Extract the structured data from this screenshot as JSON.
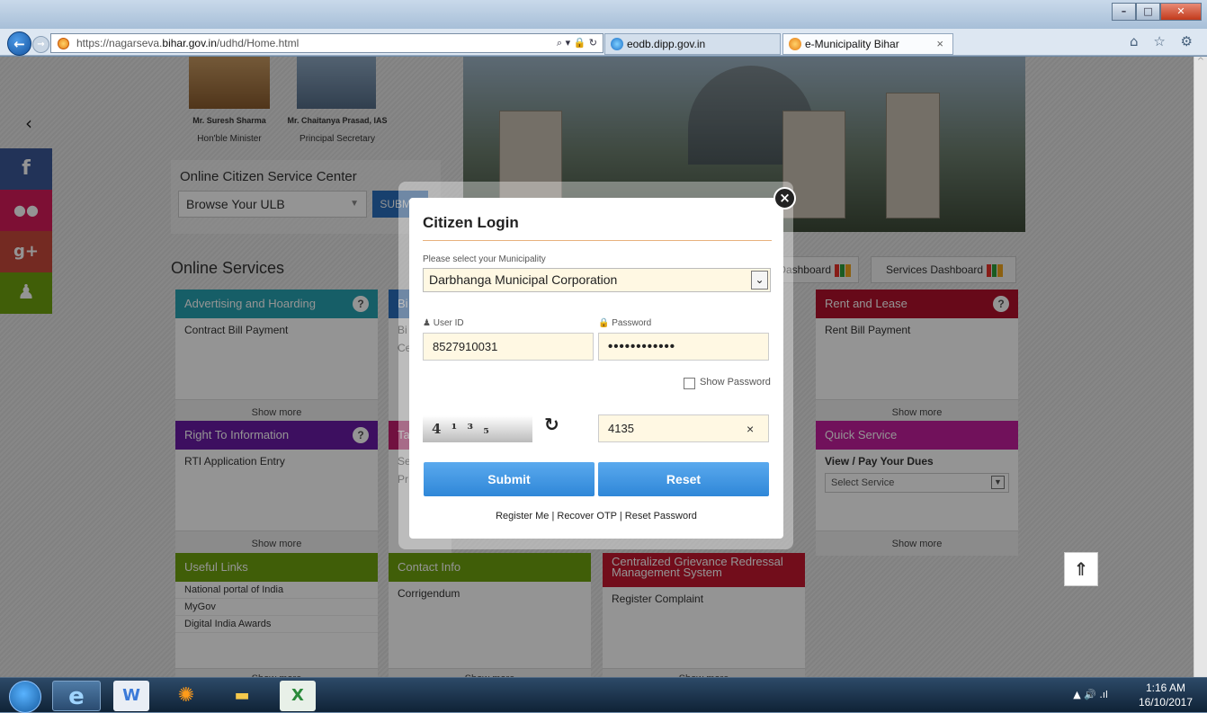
{
  "browser": {
    "url_prefix": "https://nagarseva.",
    "url_domain": "bihar.gov.in",
    "url_path": "/udhd/Home.html",
    "search_glyphs": "⌕ ▾ 🔒 ↻",
    "tabs": [
      {
        "label": "eodb.dipp.gov.in"
      },
      {
        "label": "e-Municipality Bihar",
        "close": "×"
      }
    ],
    "icons": "⌂ ☆ ⚙"
  },
  "page": {
    "officials": [
      {
        "name": "Mr. Suresh Sharma",
        "role": "Hon'ble Minister"
      },
      {
        "name": "Mr. Chaitanya Prasad, IAS",
        "role": "Principal Secretary"
      }
    ],
    "occ": {
      "title": "Online Citizen Service Center",
      "select": "Browse Your ULB",
      "submit": "SUBMIT"
    },
    "online_services": "Online Services",
    "dashboards": [
      {
        "label": "Dashboard"
      },
      {
        "label": "Services Dashboard"
      }
    ],
    "cards": [
      {
        "title": "Advertising and Hoarding",
        "items": [
          "Contract Bill Payment"
        ],
        "more": "Show more",
        "color": "#27a3b1"
      },
      {
        "title": "Rent and Lease",
        "items": [
          "Rent Bill Payment"
        ],
        "more": "Show more",
        "color": "#b2102b"
      },
      {
        "title": "Right To Information",
        "items": [
          "RTI Application Entry"
        ],
        "more": "Show more",
        "color": "#6a1aa5"
      },
      {
        "title": "Quick Service",
        "sub": "View / Pay Your Dues",
        "select": "Select Service",
        "more": "Show more",
        "color": "#c31e9e"
      },
      {
        "title": "Useful Links",
        "items": [
          "National portal of India",
          "MyGov",
          "Digital India Awards"
        ],
        "more": "Show more",
        "color": "#6fa30f"
      },
      {
        "title": "Contact Info",
        "items": [
          "Corrigendum"
        ],
        "more": "Show more",
        "color": "#6fa30f"
      },
      {
        "title": "Centralized Grievance Redressal Management System",
        "items": [
          "Register Complaint"
        ],
        "more": "Show more",
        "color": "#c4172f"
      }
    ],
    "partial": {
      "a": "Bi",
      "b": "Bi",
      "c": "Ce",
      "d": "Ta",
      "e": "Se",
      "f": "Pr"
    }
  },
  "modal": {
    "title": "Citizen Login",
    "municipality_label": "Please select your Municipality",
    "municipality": "Darbhanga Municipal Corporation",
    "userid_label": "User ID",
    "userid": "8527910031",
    "password_label": "Password",
    "password": "••••••••••••",
    "show_password": "Show Password",
    "captcha": "4 ¹ ³ ₅",
    "captcha_input": "4135",
    "submit": "Submit",
    "reset": "Reset",
    "links": [
      "Register Me",
      "Recover OTP",
      "Reset Password"
    ]
  },
  "taskbar": {
    "time": "1:16 AM",
    "date": "16/10/2017"
  },
  "colors": {
    "facebook": "#3b5998",
    "flickr": "#d81a5a",
    "gplus": "#c9493b",
    "android": "#6fa30f"
  }
}
